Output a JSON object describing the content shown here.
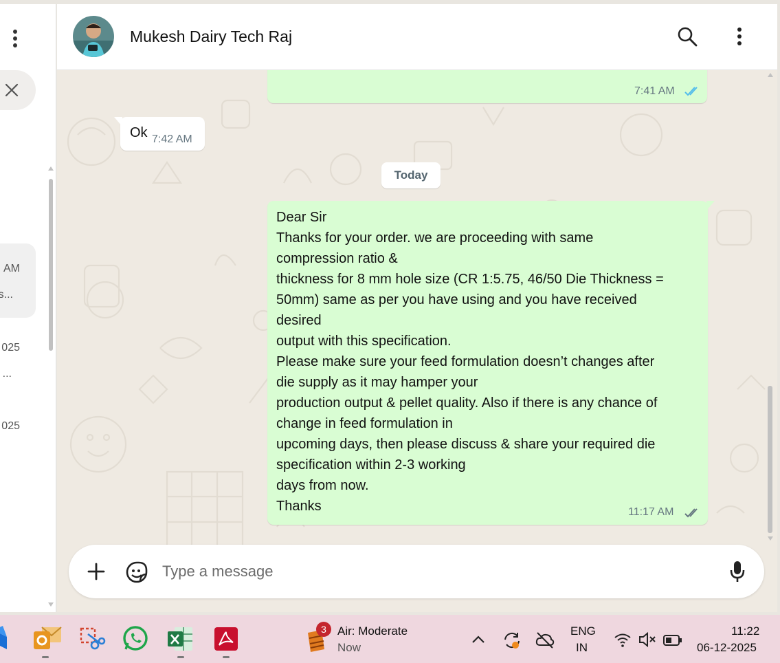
{
  "sidebar": {
    "fragments": {
      "am": "AM",
      "s": "s...",
      "y1": "025",
      "ell": "...",
      "y2": "025"
    }
  },
  "chat": {
    "contact_name": "Mukesh Dairy Tech Raj",
    "prev_out_time": "7:41 AM",
    "in_msg": {
      "text": "Ok",
      "time": "7:42 AM"
    },
    "day_divider": "Today",
    "out_msg": {
      "lines": [
        "Dear Sir",
        "Thanks for your order. we are proceeding with same",
        "compression ratio &",
        "thickness for 8 mm hole size (CR 1:5.75, 46/50 Die Thickness =",
        "50mm) same as per you have using and  you have received",
        "desired",
        "output with this specification.",
        "Please make sure your feed formulation doesn’t changes after",
        "die supply as it may hamper your",
        "production output & pellet quality. Also if there is any chance of",
        "change in feed formulation in",
        "upcoming days, then please discuss & share your required die",
        "specification within 2-3 working",
        "days from now.",
        "Thanks"
      ],
      "time": "11:17 AM"
    },
    "composer_placeholder": "Type a message"
  },
  "taskbar": {
    "weather_badge": "3",
    "weather_title": "Air: Moderate",
    "weather_sub": "Now",
    "lang_top": "ENG",
    "lang_bottom": "IN",
    "clock_time": "11:22",
    "clock_date": "06-12-2025"
  },
  "colors": {
    "outgoing_bubble": "#d9fdd3",
    "incoming_bubble": "#ffffff",
    "read_tick_blue": "#53bdeb",
    "chat_background": "#efeae2",
    "taskbar": "#efd7df"
  },
  "icons": [
    "kebab-menu-icon",
    "close-icon",
    "search-icon",
    "plus-icon",
    "sticker-icon",
    "microphone-icon",
    "double-check-icon",
    "chevron-up-icon",
    "sync-icon",
    "cloud-off-icon",
    "wifi-icon",
    "speaker-muted-icon",
    "battery-icon"
  ]
}
